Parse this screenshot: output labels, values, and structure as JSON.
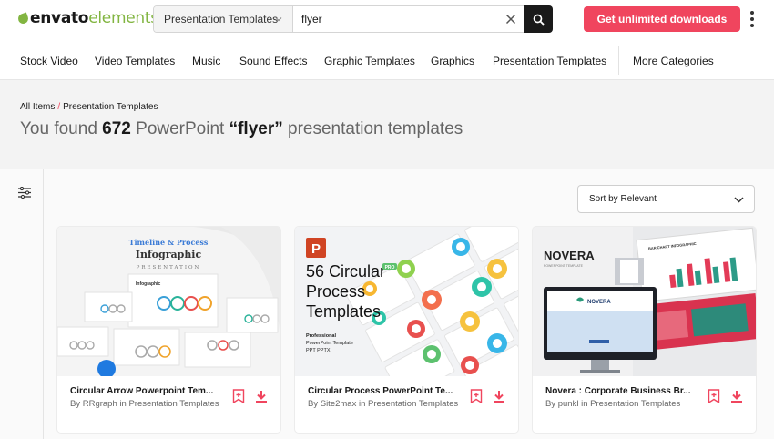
{
  "logo": {
    "brand": "envato",
    "suffix": "elements"
  },
  "search": {
    "category": "Presentation Templates",
    "query": "flyer"
  },
  "cta_label": "Get unlimited downloads",
  "nav": [
    "Stock Video",
    "Video Templates",
    "Music",
    "Sound Effects",
    "Graphic Templates",
    "Graphics",
    "Presentation Templates",
    "More Categories"
  ],
  "breadcrumb": {
    "root": "All Items",
    "separator": "/",
    "current": "Presentation Templates"
  },
  "headline": {
    "prefix": "You found",
    "count": "672",
    "middle": "PowerPoint",
    "query": "“flyer”",
    "suffix": "presentation templates"
  },
  "sort_label": "Sort by Relevant",
  "cards": [
    {
      "title": "Circular Arrow Powerpoint Tem...",
      "by": "By",
      "author": "RRgraph",
      "in": "in Presentation Templates",
      "thumb": {
        "kicker": "Timeline & Process",
        "heading": "Infographic",
        "sub": "PRESENTATION",
        "slide_label": "Infographic"
      }
    },
    {
      "title": "Circular Process PowerPoint Te...",
      "by": "By",
      "author": "Site2max",
      "in": "in Presentation Templates",
      "thumb": {
        "line1": "56 Circular",
        "line2": "Process",
        "line3": "Templates",
        "badge": "P",
        "tag": "PRO",
        "small1": "Professional",
        "small2": "PowerPoint Template",
        "small3": "PPT PPTX"
      }
    },
    {
      "title": "Novera : Corporate Business Br...",
      "by": "By",
      "author": "punkl",
      "in": "in Presentation Templates",
      "thumb": {
        "brand": "NOVERA",
        "tagline": "POWERPOINT TEMPLATE",
        "screen_brand": "NOVERA",
        "chart_title": "BAR CHART INFOGRAPHIC"
      }
    }
  ],
  "colors": {
    "accent": "#f0455e",
    "logo_green": "#82b541"
  }
}
